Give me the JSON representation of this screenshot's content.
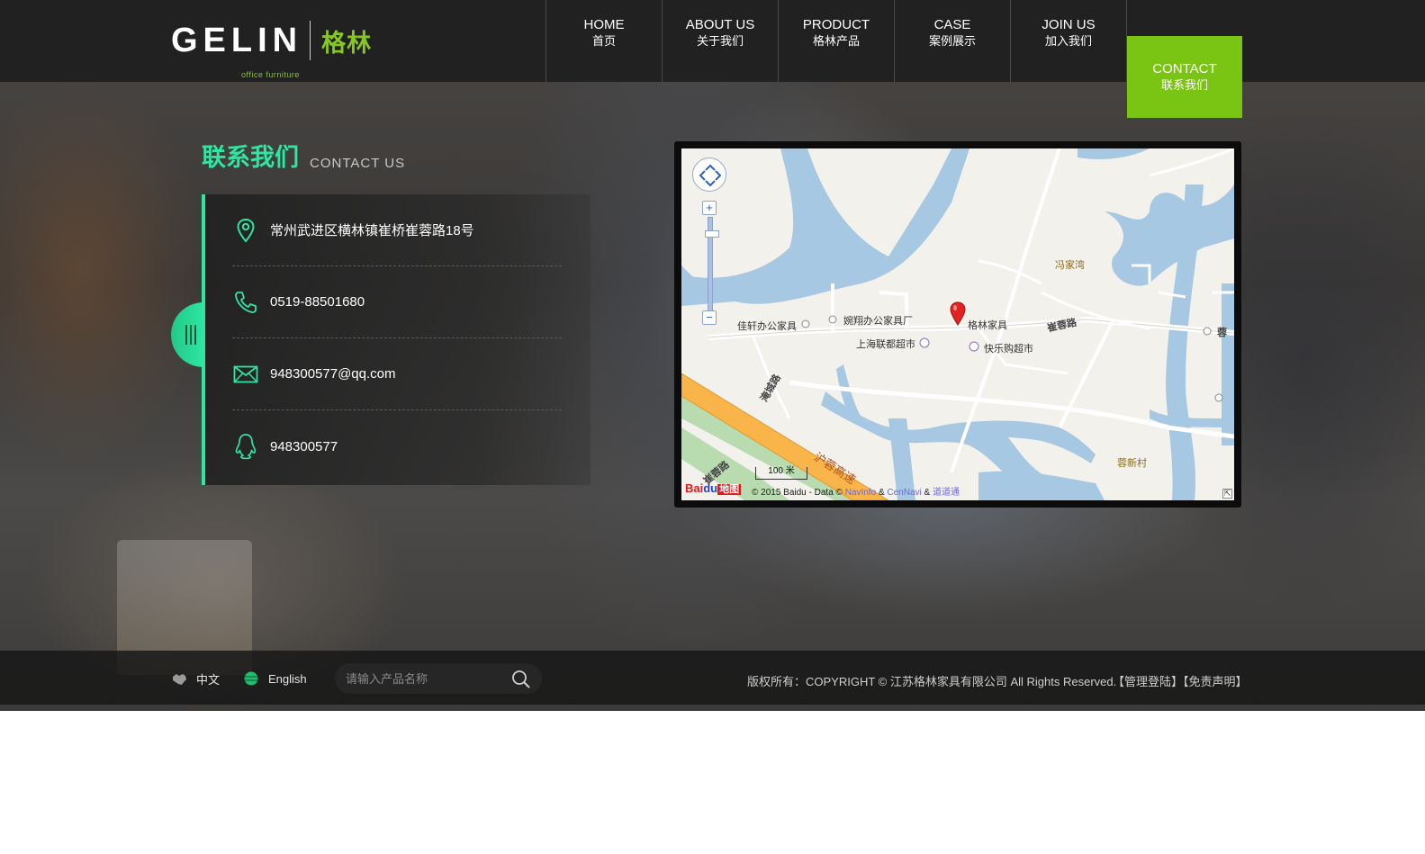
{
  "brand": {
    "name": "GELIN",
    "tagline": "office furniture",
    "name_cn": "格林"
  },
  "nav": {
    "items": [
      {
        "en": "HOME",
        "cn": "首页"
      },
      {
        "en": "ABOUT US",
        "cn": "关于我们"
      },
      {
        "en": "PRODUCT",
        "cn": "格林产品"
      },
      {
        "en": "CASE",
        "cn": "案例展示"
      },
      {
        "en": "JOIN US",
        "cn": "加入我们"
      },
      {
        "en": "CONTACT",
        "cn": "联系我们"
      }
    ],
    "active_index": 5
  },
  "contact": {
    "title_cn": "联系我们",
    "title_en": "CONTACT US",
    "address": "常州武进区横林镇崔桥崔蓉路18号",
    "phone": "0519-88501680",
    "email": "948300577@qq.com",
    "qq": "948300577"
  },
  "map": {
    "labels": {
      "village1": "冯家湾",
      "village2": "蓉新村",
      "place1": "佳轩办公家具",
      "place2": "婉翔办公家具厂",
      "place3": "格林家具",
      "place4": "上海联都超市",
      "place5": "快乐购超市",
      "road1": "崔蓉路",
      "road2": "沪蓉高速",
      "road3": "蓉",
      "road4": "崔蓉路",
      "road5": "淹城路"
    },
    "scale": "100 米",
    "copyright_prefix": "© 2015 Baidu - Data ©",
    "copyright_a": "NavInfo",
    "copyright_amp1": "&",
    "copyright_b": "CenNavi",
    "copyright_amp2": "&",
    "copyright_c": "道道通",
    "logo_a": "Bai",
    "logo_b": "du",
    "logo_c": "地图"
  },
  "footer": {
    "lang_cn": "中文",
    "lang_en": "English",
    "search_placeholder": "请输入产品名称",
    "copyright": "版权所有：COPYRIGHT © 江苏格林家具有限公司  All Rights Reserved.",
    "admin_login": "【管理登陆】",
    "disclaimer": "【免责声明】"
  },
  "colors": {
    "accent_green": "#7ac414",
    "mint": "#2ee5a2"
  }
}
